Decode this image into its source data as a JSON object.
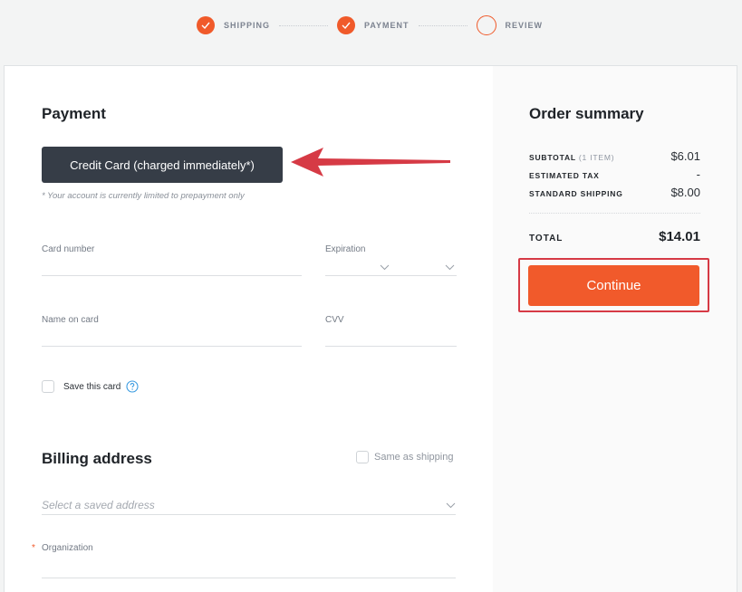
{
  "stepper": {
    "steps": [
      {
        "label": "SHIPPING",
        "state": "complete"
      },
      {
        "label": "PAYMENT",
        "state": "complete"
      },
      {
        "label": "REVIEW",
        "state": "pending"
      }
    ]
  },
  "payment": {
    "title": "Payment",
    "method_button": "Credit Card (charged immediately*)",
    "note": "* Your account is currently limited to prepayment only",
    "fields": {
      "card_number": {
        "label": "Card number",
        "value": ""
      },
      "expiration": {
        "label": "Expiration",
        "month": "",
        "year": ""
      },
      "name_on_card": {
        "label": "Name on card",
        "value": ""
      },
      "cvv": {
        "label": "CVV",
        "value": ""
      }
    },
    "save_card": {
      "label": "Save this card",
      "checked": false
    }
  },
  "billing": {
    "title": "Billing address",
    "same_as_shipping": {
      "label": "Same as shipping",
      "checked": false
    },
    "saved_address_placeholder": "Select a saved address",
    "organization": {
      "label": "Organization",
      "required_mark": "*",
      "value": ""
    }
  },
  "summary": {
    "title": "Order summary",
    "rows": [
      {
        "label": "SUBTOTAL",
        "sub": "(1 ITEM)",
        "value": "$6.01"
      },
      {
        "label": "ESTIMATED TAX",
        "sub": "",
        "value": "-"
      },
      {
        "label": "STANDARD SHIPPING",
        "sub": "",
        "value": "$8.00"
      }
    ],
    "total_label": "TOTAL",
    "total_value": "$14.01",
    "continue_label": "Continue"
  },
  "colors": {
    "accent": "#f05a2a",
    "dark_button": "#363d47",
    "annotation_red": "#d63a45",
    "help_blue": "#3a9be0"
  }
}
